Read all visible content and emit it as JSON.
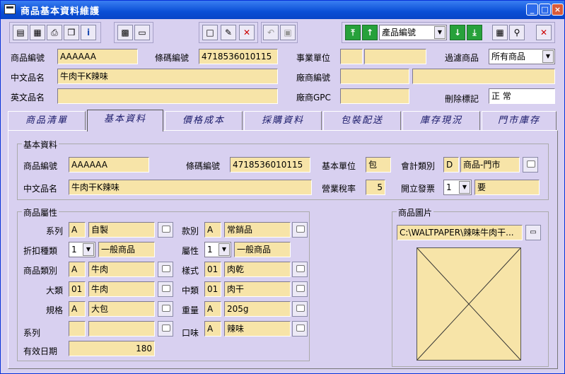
{
  "window": {
    "title": "商品基本資料維護"
  },
  "toolbar": {
    "search_field_value": "產品編號"
  },
  "header": {
    "product_no_label": "商品編號",
    "product_no": "AAAAAA",
    "barcode_label": "條碼編號",
    "barcode": "4718536010115",
    "business_unit_label": "事業單位",
    "filter_label": "過濾商品",
    "filter_value": "所有商品",
    "cn_name_label": "中文品名",
    "cn_name": "牛肉干K辣味",
    "vendor_no_label": "廠商編號",
    "en_name_label": "英文品名",
    "vendor_gpc_label": "廠商GPC",
    "delete_mark_label": "刪除標記",
    "delete_mark": "正  常"
  },
  "tabs": [
    {
      "label": "商品清單"
    },
    {
      "label": "基本資料"
    },
    {
      "label": "價格成本"
    },
    {
      "label": "採購資料"
    },
    {
      "label": "包裝配送"
    },
    {
      "label": "庫存現況"
    },
    {
      "label": "門市庫存"
    }
  ],
  "basic": {
    "group_title": "基本資料",
    "product_no_label": "商品編號",
    "product_no": "AAAAAA",
    "barcode_label": "條碼編號",
    "barcode": "4718536010115",
    "unit_label": "基本單位",
    "unit": "包",
    "acct_label": "會計類別",
    "acct_code": "D",
    "acct_name": "商品-門市",
    "cn_name_label": "中文品名",
    "cn_name": "牛肉干K辣味",
    "tax_label": "營業稅率",
    "tax": "5",
    "invoice_label": "開立發票",
    "invoice_code": "1",
    "invoice_value": "要"
  },
  "attrs": {
    "group_title": "商品屬性",
    "series_label": "系列",
    "series_code": "A",
    "series_name": "自製",
    "style_label": "款別",
    "style_code": "A",
    "style_name": "常銷品",
    "discount_label": "折扣種類",
    "discount_code": "1",
    "discount_name": "一般商品",
    "property_label": "屬性",
    "property_code": "1",
    "property_name": "一般商品",
    "category_label": "商品類別",
    "category_code": "A",
    "category_name": "牛肉",
    "pattern_label": "樣式",
    "pattern_code": "01",
    "pattern_name": "肉乾",
    "major_label": "大類",
    "major_code": "01",
    "major_name": "牛肉",
    "middle_label": "中類",
    "middle_code": "01",
    "middle_name": "肉干",
    "spec_label": "規格",
    "spec_code": "A",
    "spec_name": "大包",
    "weight_label": "重量",
    "weight_code": "A",
    "weight_name": "205g",
    "series2_label": "系列",
    "series2_code": "",
    "series2_name": "",
    "flavor_label": "口味",
    "flavor_code": "A",
    "flavor_name": "辣味",
    "expiry_label": "有效日期",
    "expiry": "180"
  },
  "picture": {
    "group_title": "商品圖片",
    "path": "C:\\WALTPAPER\\辣味牛肉干..."
  }
}
